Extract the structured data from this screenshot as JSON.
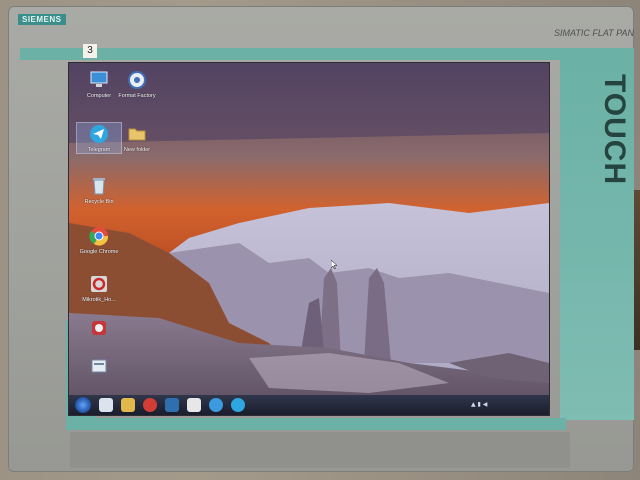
{
  "monitor": {
    "brand": "SIEMENS",
    "model": "SIMATIC FLAT PAN",
    "touch_label": "TOUCH",
    "sticker": "3"
  },
  "desktop": {
    "icons": [
      {
        "label": "Computer",
        "icon": "computer-icon"
      },
      {
        "label": "Format Factory",
        "icon": "format-factory-icon"
      },
      {
        "label": "Telegram",
        "icon": "telegram-icon"
      },
      {
        "label": "New folder",
        "icon": "folder-icon"
      },
      {
        "label": "Recycle Bin",
        "icon": "recycle-bin-icon"
      },
      {
        "label": "Google Chrome",
        "icon": "chrome-icon"
      },
      {
        "label": "Mikrotik_Ho...",
        "icon": "app-icon"
      },
      {
        "label": "",
        "icon": "app-icon"
      },
      {
        "label": "",
        "icon": "app-icon"
      }
    ]
  },
  "taskbar": {
    "pinned": [
      "start-button",
      "explorer-icon",
      "chrome-icon",
      "opera-icon",
      "folder-icon",
      "media-icon",
      "ie-icon",
      "telegram-icon"
    ],
    "time": "",
    "date": ""
  },
  "colors": {
    "teal": "#6bb1a6",
    "bezel": "#a3a49f",
    "brand_badge": "#3a8f8b"
  }
}
